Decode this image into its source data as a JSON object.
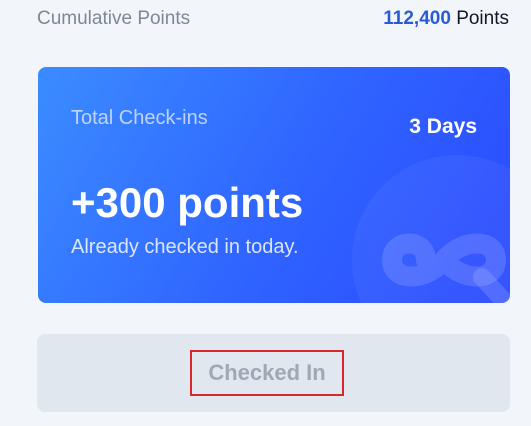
{
  "summary": {
    "cumulative_label": "Cumulative Points",
    "cumulative_value": "112,400",
    "cumulative_unit": "Points"
  },
  "card": {
    "title": "Total Check-ins",
    "days": "3 Days",
    "points": "+300 points",
    "subtitle": "Already checked in today.",
    "background_colors": [
      "#3b8cff",
      "#2f63ff",
      "#2b49ff"
    ],
    "decoration_icon": "infinity-q-icon"
  },
  "button": {
    "label": "Checked In",
    "state": "disabled",
    "highlight_color": "#d9272e"
  }
}
